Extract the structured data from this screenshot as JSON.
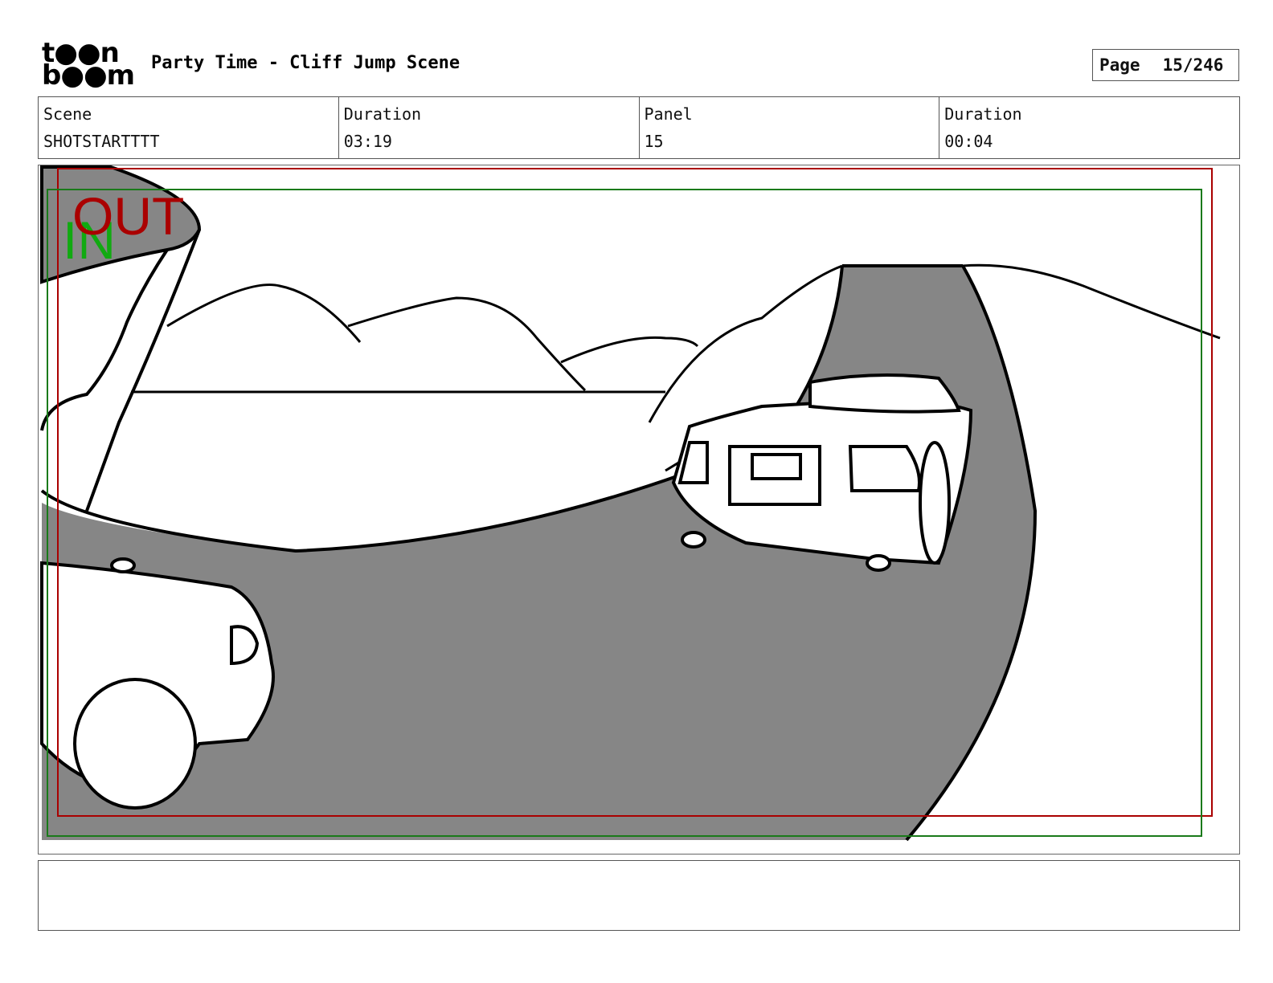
{
  "header": {
    "logo_line1": "t●●n",
    "logo_line2": "b●●m",
    "title": "Party Time - Cliff Jump Scene",
    "page_label": "Page",
    "page_value": "15/246"
  },
  "info": {
    "scene_label": "Scene",
    "scene_value": "SHOTSTARTTTT",
    "scene_duration_label": "Duration",
    "scene_duration_value": "03:19",
    "panel_label": "Panel",
    "panel_value": "15",
    "panel_duration_label": "Duration",
    "panel_duration_value": "00:04"
  },
  "frame": {
    "in_label": "IN",
    "out_label": "OUT",
    "in_color": "#11aa11",
    "out_color": "#aa0000"
  },
  "notes": {
    "text": ""
  }
}
